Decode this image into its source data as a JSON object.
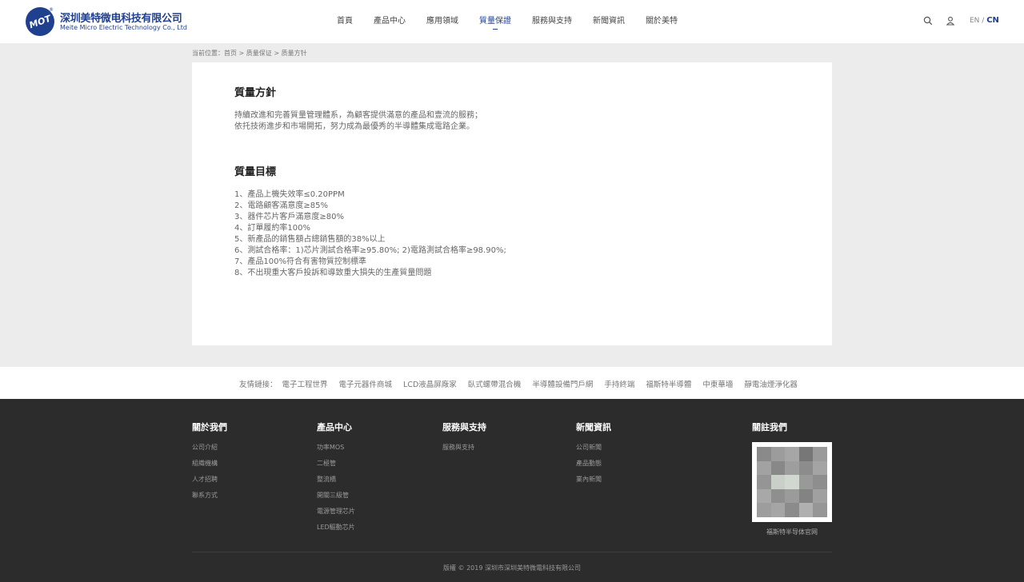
{
  "header": {
    "logo_cn": "深圳美特微电科技有限公司",
    "logo_en": "Meite Micro Electric Technology Co., Ltd",
    "logo_mark": "MOT",
    "logo_reg": "®",
    "nav": [
      {
        "label": "首頁"
      },
      {
        "label": "產品中心"
      },
      {
        "label": "應用領域"
      },
      {
        "label": "質量保證"
      },
      {
        "label": "服務與支持"
      },
      {
        "label": "新聞資訊"
      },
      {
        "label": "關於美特"
      }
    ],
    "active_nav": "質量保證",
    "lang_en": "EN",
    "lang_sep": "/",
    "lang_cn": "CN",
    "icons": [
      "search-icon",
      "user-icon"
    ]
  },
  "breadcrumb": {
    "prefix": "当前位置：",
    "items": [
      "首页",
      "质量保证",
      "质量方针"
    ],
    "separator": ">"
  },
  "content": {
    "policy_title": "質量方針",
    "policy_lines": [
      "持續改進和完善質量管理體系，為顧客提供滿意的產品和壹流的服務；",
      "依托技術進步和市場開拓，努力成為最優秀的半導體集成電路企業。"
    ],
    "goals_title": "質量目標",
    "goals": [
      "1、產品上機失效率≤0.20PPM",
      "2、電路顧客滿意度≥85%",
      "3、器件芯片客戶滿意度≥80%",
      "4、訂單履約率100%",
      "5、新產品的銷售額占總銷售額的38%以上",
      "6、測試合格率：1)芯片測試合格率≥95.80%; 2)電路測試合格率≥98.90%;",
      "7、產品100%符合有害物質控制標準",
      "8、不出現重大客戶投訴和導致重大損失的生產質量問題"
    ]
  },
  "friend_links": {
    "label": "友情鏈接：",
    "items": [
      "電子工程世界",
      "電子元器件商城",
      "LCD液晶屏廠家",
      "臥式螺帶混合機",
      "半導體設備門戶網",
      "手持終端",
      "福斯特半導體",
      "中東華墻",
      "靜電油煙淨化器"
    ]
  },
  "footer": {
    "columns": [
      {
        "title": "關於我們",
        "links": [
          "公司介紹",
          "組織機構",
          "人才招聘",
          "聯系方式"
        ]
      },
      {
        "title": "產品中心",
        "links": [
          "功率MOS",
          "二極管",
          "整流橋",
          "開關三級管",
          "電源管理芯片",
          "LED驅動芯片"
        ]
      },
      {
        "title": "服務與支持",
        "links": [
          "服務與支持"
        ]
      },
      {
        "title": "新聞資訊",
        "links": [
          "公司新聞",
          "產品動態",
          "業內新聞"
        ]
      }
    ],
    "follow_title": "關註我們",
    "qr_caption": "福斯特半导体官网",
    "copyright": "版權 © 2019 深圳市深圳美特微電科技有限公司",
    "colors": {
      "background": "#2c2c2c",
      "accent": "#1f3f8f"
    }
  }
}
